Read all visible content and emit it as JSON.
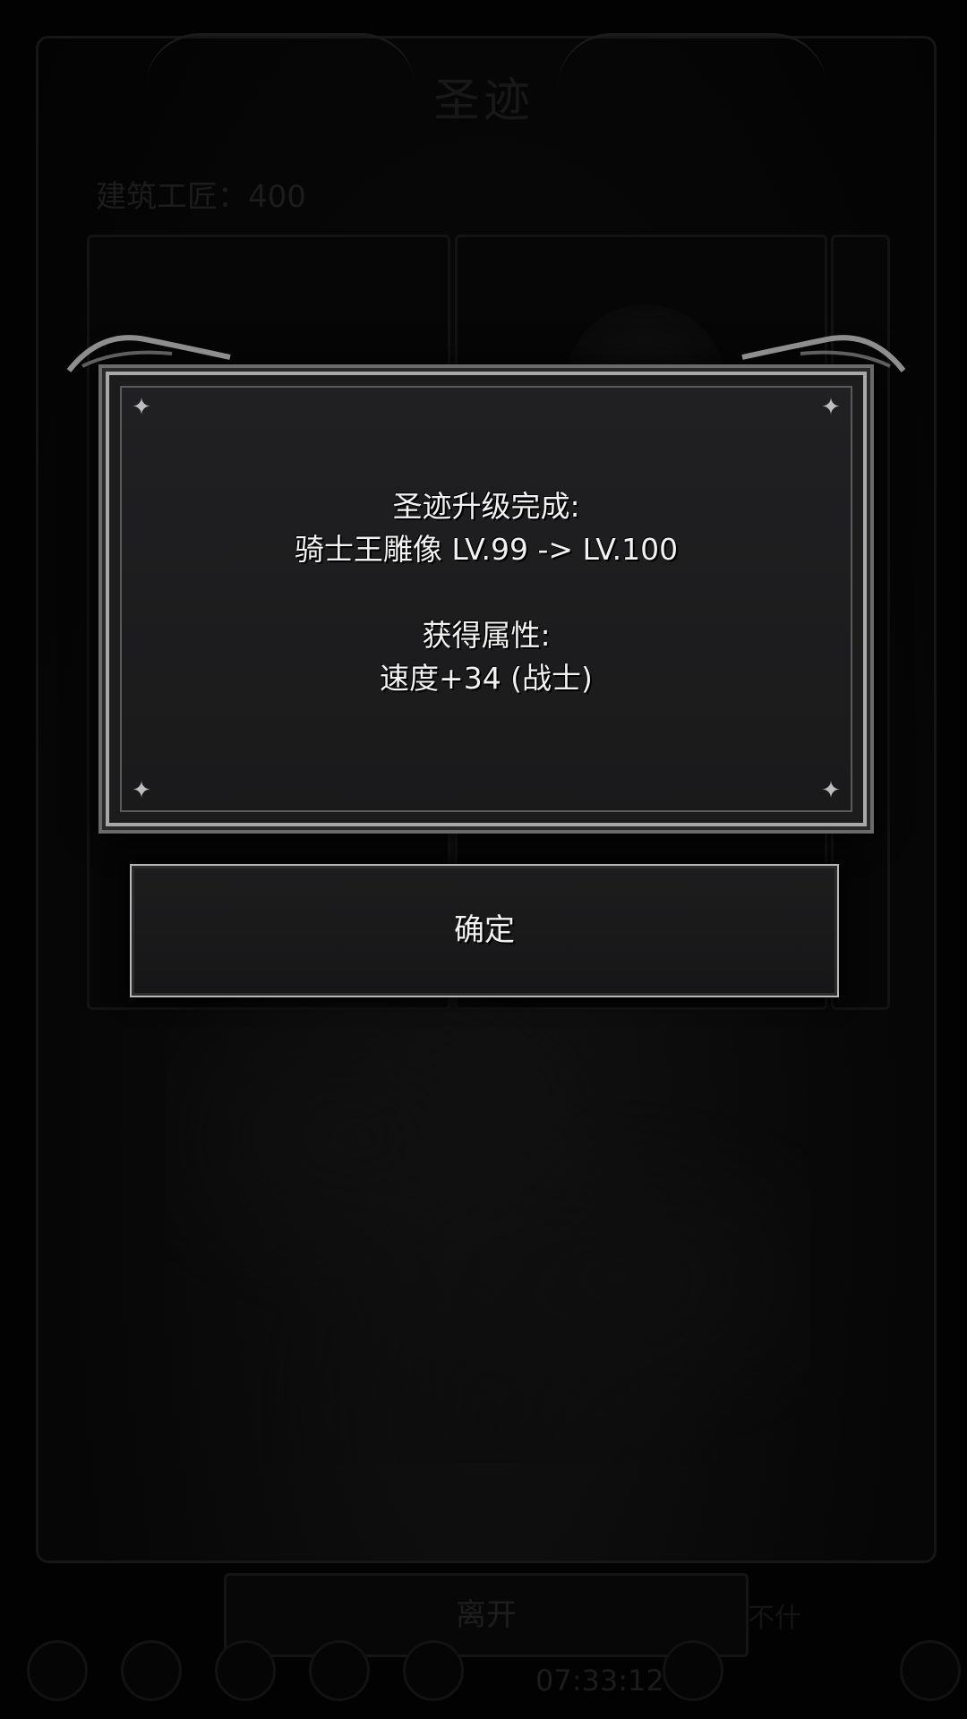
{
  "background": {
    "title": "圣迹",
    "builder_label": "建筑工匠：400",
    "leave_button": "离开",
    "side_text": "不什",
    "clock": "07:33:12"
  },
  "modal": {
    "heading": "圣迹升级完成:",
    "upgrade_line": "骑士王雕像 LV.99 -> LV.100",
    "attributes_heading": "获得属性:",
    "attribute_line": "速度+34 (战士)",
    "confirm_label": "确定"
  },
  "colors": {
    "modal_background": "#1c1c1d",
    "modal_border": "#a9a9a9",
    "text": "#f2f2f2",
    "backdrop": "#020202"
  },
  "icons": [
    "sparkle-icon",
    "bottom-nav-icon"
  ]
}
